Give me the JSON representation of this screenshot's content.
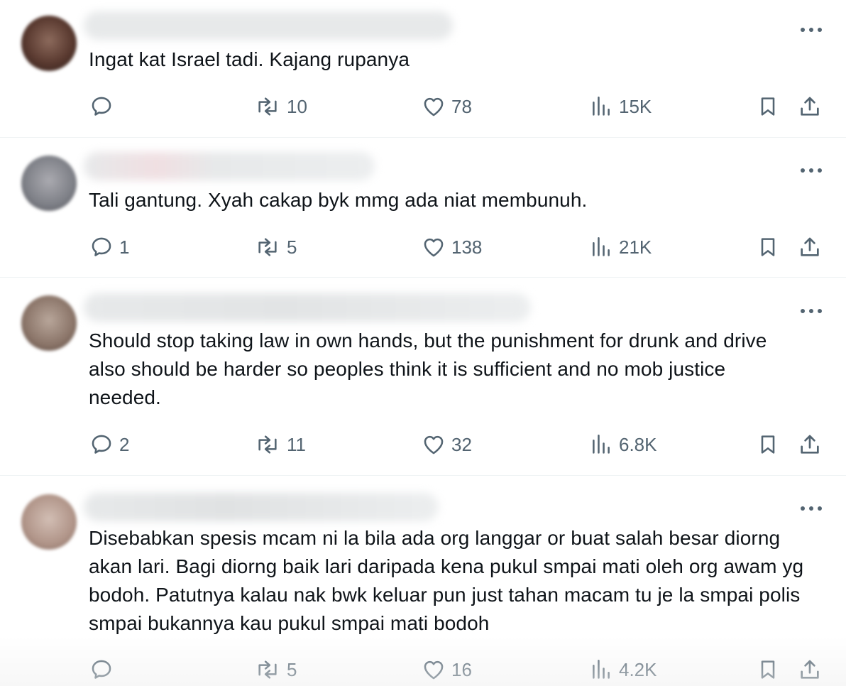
{
  "replies": [
    {
      "text": "Ingat kat Israel tadi. Kajang rupanya",
      "stats": {
        "replies": "",
        "reposts": "10",
        "likes": "78",
        "views": "15K"
      },
      "colors": {
        "avatar": "#5a3a30",
        "avatar_light": "#8c6a5c"
      }
    },
    {
      "text": "Tali gantung. Xyah cakap byk mmg ada niat membunuh.",
      "stats": {
        "replies": "1",
        "reposts": "5",
        "likes": "138",
        "views": "21K"
      },
      "colors": {
        "avatar": "#7d7f86",
        "avatar_light": "#aaaab0"
      }
    },
    {
      "text": "Should stop taking law in own hands, but the punishment for drunk and drive also should be harder so peoples think it is sufficient and no mob justice needed.",
      "stats": {
        "replies": "2",
        "reposts": "11",
        "likes": "32",
        "views": "6.8K"
      },
      "colors": {
        "avatar": "#8a7468",
        "avatar_light": "#b8a69a"
      }
    },
    {
      "text": "Disebabkan spesis mcam ni la bila ada org langgar or buat salah besar diorng akan lari. Bagi diorng baik lari daripada kena pukul smpai mati oleh org awam yg bodoh. Patutnya kalau nak bwk keluar pun just tahan macam tu je la smpai polis smpai bukannya kau pukul smpai mati bodoh",
      "stats": {
        "replies": "",
        "reposts": "5",
        "likes": "16",
        "views": "4.2K"
      },
      "colors": {
        "avatar": "#b09488",
        "avatar_light": "#d2beb4"
      }
    }
  ],
  "icons": {
    "reply": "reply-icon",
    "repost": "repost-icon",
    "like": "heart-icon",
    "views": "views-icon",
    "bookmark": "bookmark-icon",
    "share": "share-icon",
    "more": "more-icon"
  },
  "theme": {
    "icon_color": "#536471",
    "text_color": "#0f1419",
    "divider": "#eff3f4"
  }
}
